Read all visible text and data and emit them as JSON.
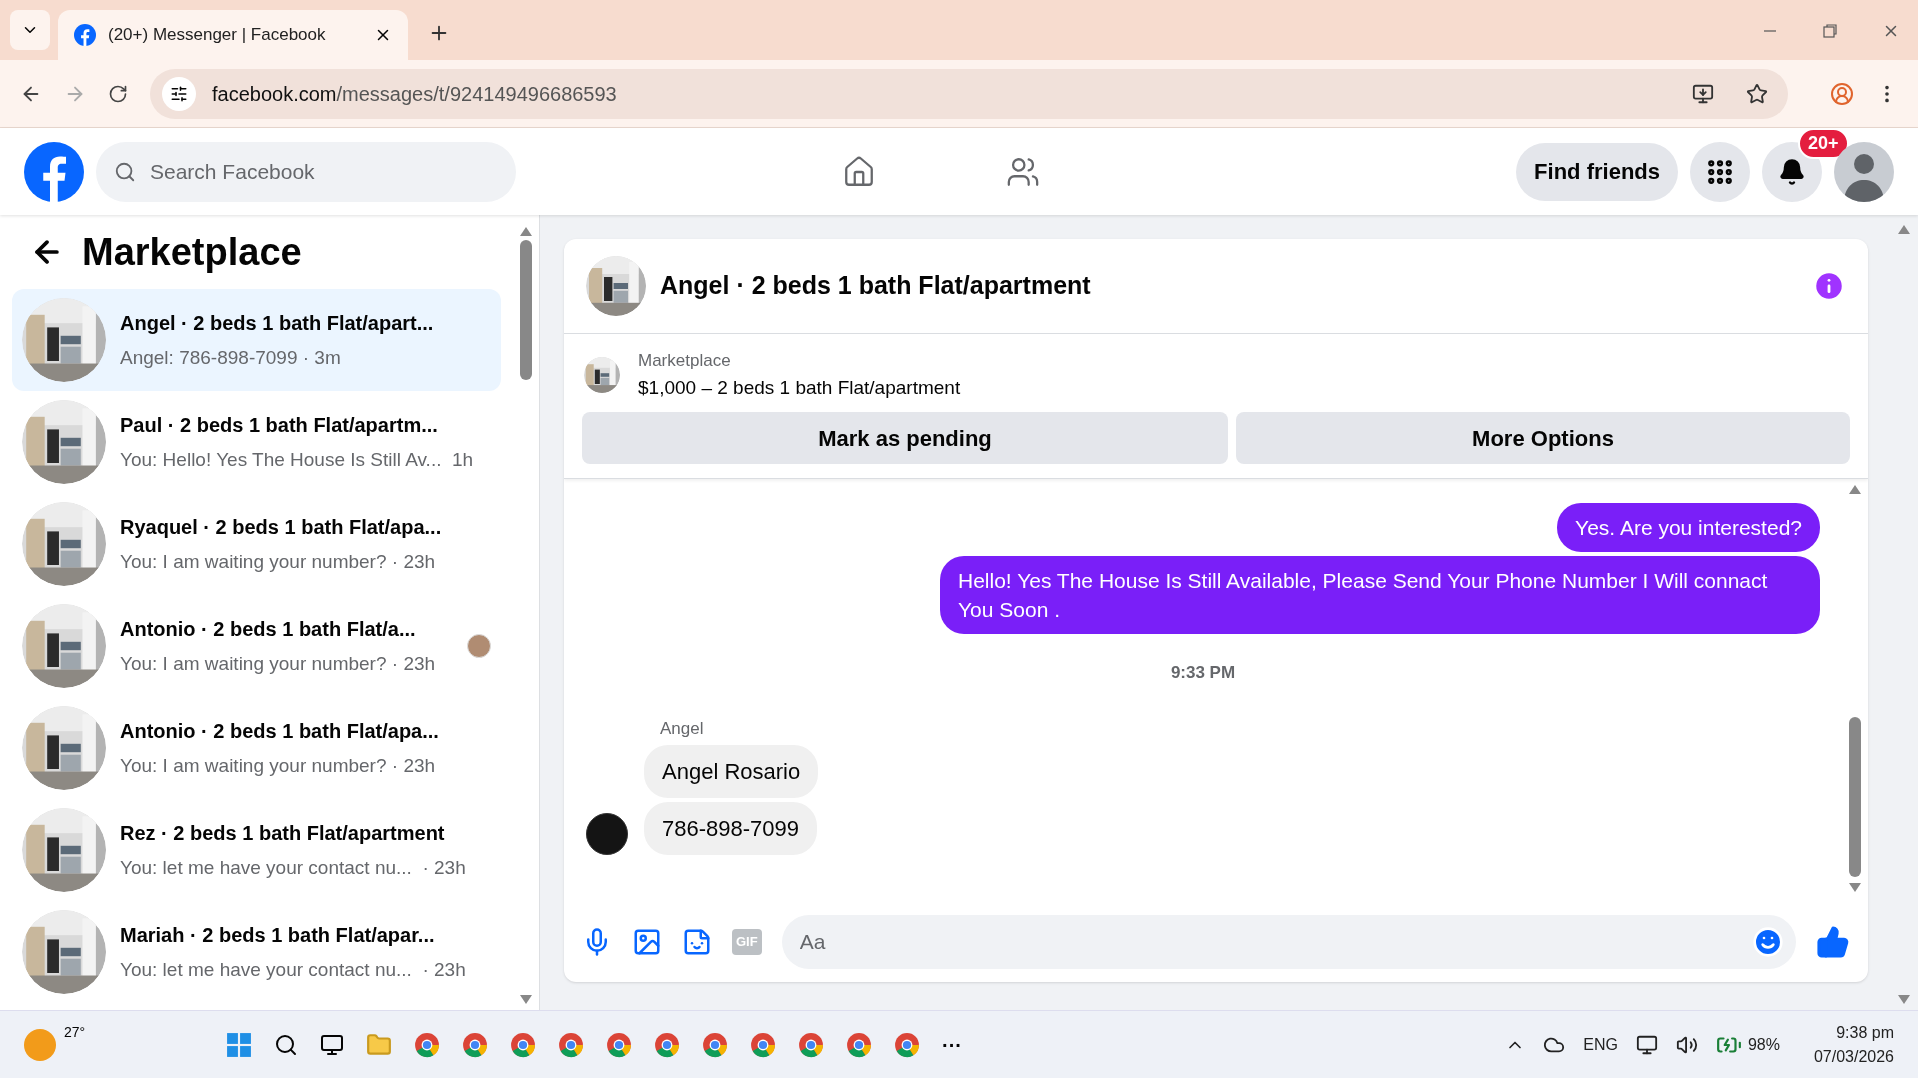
{
  "browser": {
    "tab_title": "(20+) Messenger | Facebook",
    "address_host": "facebook.com",
    "address_path": "/messages/t/924149496686593"
  },
  "header": {
    "search_placeholder": "Search Facebook",
    "find_friends": "Find friends",
    "notification_badge": "20+"
  },
  "sidebar": {
    "title": "Marketplace",
    "items": [
      {
        "title": "Angel · 2 beds 1 bath Flat/apart...",
        "preview": "Angel: 786-898-7099 · 3m",
        "selected": true,
        "seen_avatar": false
      },
      {
        "title": "Paul · 2 beds 1 bath Flat/apartm...",
        "preview": "You: Hello! Yes The House Is Still Av...  1h",
        "selected": false,
        "seen_avatar": false
      },
      {
        "title": "Ryaquel · 2 beds 1 bath Flat/apa...",
        "preview": "You: I am waiting your number? · 23h",
        "selected": false,
        "seen_avatar": false
      },
      {
        "title": "Antonio · 2 beds 1 bath Flat/a...",
        "preview": "You: I am waiting your number? · 23h",
        "selected": false,
        "seen_avatar": true
      },
      {
        "title": "Antonio · 2 beds 1 bath Flat/apa...",
        "preview": "You: I am waiting your number? · 23h",
        "selected": false,
        "seen_avatar": false
      },
      {
        "title": "Rez · 2 beds 1 bath Flat/apartment",
        "preview": "You: let me have your contact nu...  · 23h",
        "selected": false,
        "seen_avatar": false
      },
      {
        "title": "Mariah · 2 beds 1 bath Flat/apar...",
        "preview": "You: let me have your contact nu...  · 23h",
        "selected": false,
        "seen_avatar": false
      }
    ]
  },
  "chat": {
    "title": "Angel · 2 beds 1 bath Flat/apartment",
    "listing_label": "Marketplace",
    "listing": "$1,000 – 2 beds 1 bath Flat/apartment",
    "buttons": [
      "Mark as pending",
      "More Options"
    ],
    "messages": [
      {
        "kind": "sent",
        "text": "Yes. Are you interested?"
      },
      {
        "kind": "sent",
        "text": "Hello! Yes The House  Is Still Available, Please Send Your Phone Number I Will connact You Soon ."
      },
      {
        "kind": "time",
        "text": "9:33 PM"
      },
      {
        "kind": "sender",
        "text": "Angel"
      },
      {
        "kind": "received",
        "text": "Angel Rosario",
        "avatar": false
      },
      {
        "kind": "received",
        "text": "786-898-7099",
        "avatar": true
      }
    ],
    "composer": {
      "gif": "GIF",
      "placeholder": "Aa"
    }
  },
  "taskbar": {
    "weather": "27°",
    "more": "···",
    "language": "ENG",
    "battery": "98%",
    "time": "9:38 pm",
    "date": "07/03/2026"
  }
}
